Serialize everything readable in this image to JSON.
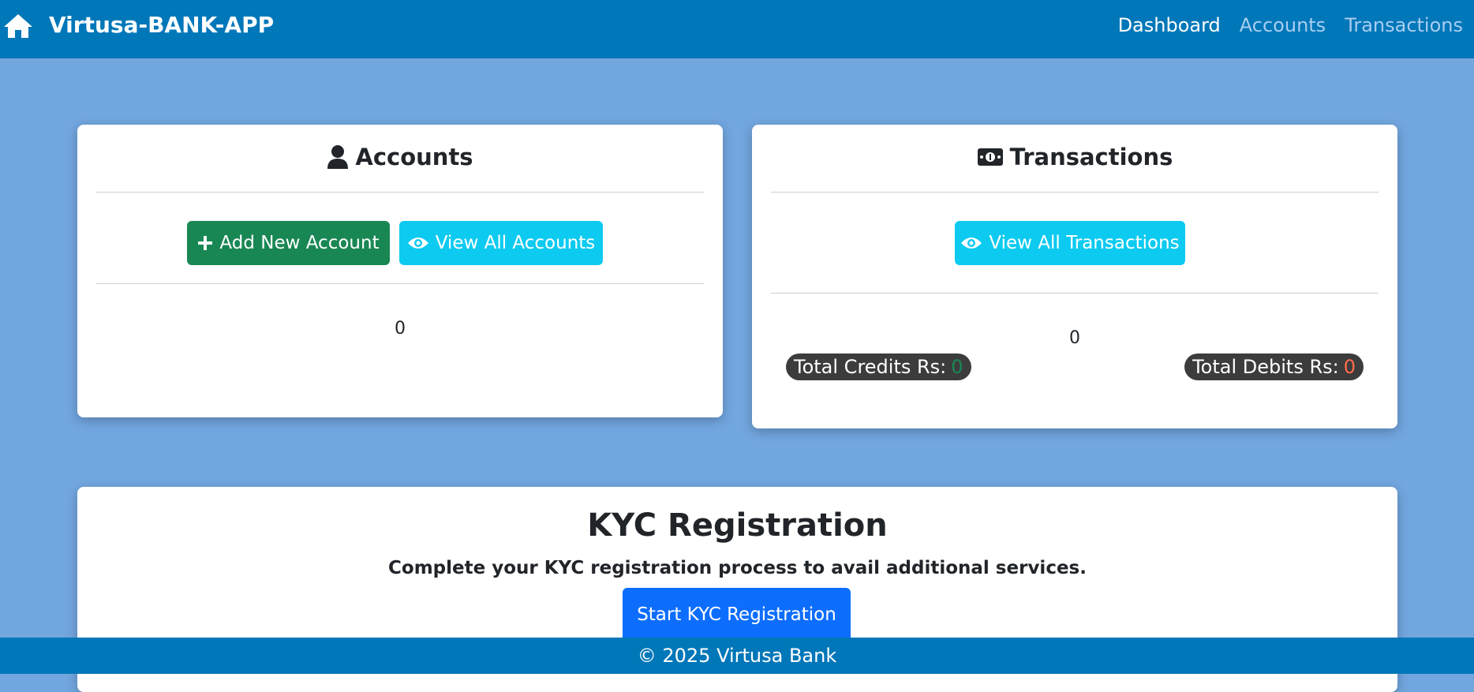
{
  "navbar": {
    "brand": "Virtusa-BANK-APP",
    "brand_icon": "home-icon",
    "links": [
      {
        "label": "Dashboard",
        "active": true
      },
      {
        "label": "Accounts",
        "active": false
      },
      {
        "label": "Transactions",
        "active": false
      }
    ]
  },
  "accounts_card": {
    "title": "Accounts",
    "icon": "user-icon",
    "add_button": "Add New Account",
    "view_button": "View All Accounts",
    "count": "0"
  },
  "transactions_card": {
    "title": "Transactions",
    "icon": "money-bill-icon",
    "view_button": "View All Transactions",
    "count": "0",
    "credits_label": "Total Credits Rs:",
    "credits_value": "0",
    "debits_label": "Total Debits Rs:",
    "debits_value": "0"
  },
  "kyc": {
    "title": "KYC Registration",
    "description": "Complete your KYC registration process to avail additional services.",
    "button": "Start KYC Registration"
  },
  "footer": {
    "text": "© 2025 Virtusa Bank"
  },
  "colors": {
    "navbar": "#0077b9",
    "background": "#72a6df",
    "green": "#198754",
    "cyan": "#0dcaf0",
    "blue": "#0d6efd",
    "debit": "#ff6b4a"
  }
}
